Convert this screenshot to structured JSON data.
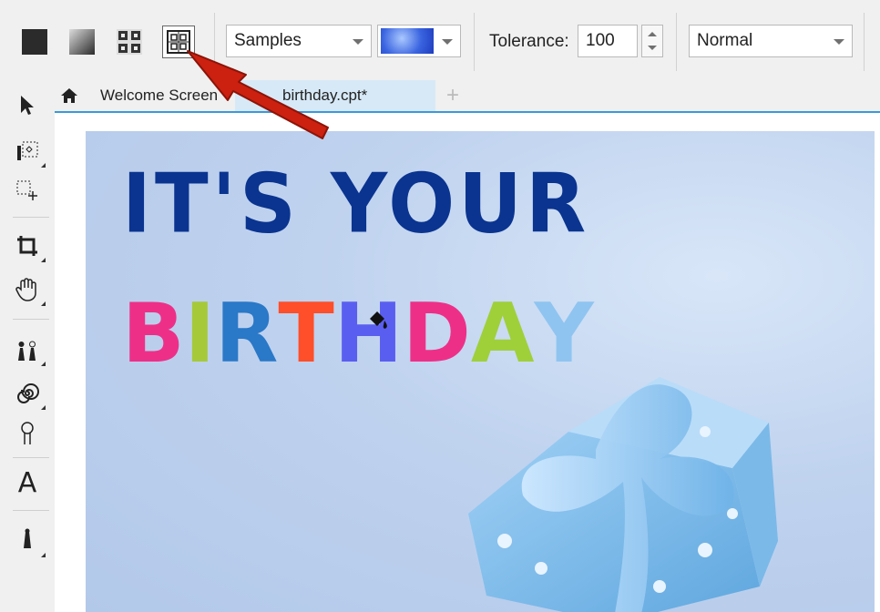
{
  "property_bar": {
    "tools": [
      "fill-flat-icon",
      "fill-gradient-icon",
      "fill-pattern-icon",
      "fill-texture-icon"
    ],
    "library_dropdown": "Samples",
    "texture_preview": "texture-swatch",
    "tolerance_label": "Tolerance:",
    "tolerance_value": "100",
    "blend_mode": "Normal"
  },
  "tabs": [
    {
      "label": "Welcome Screen",
      "active": false
    },
    {
      "label": "birthday.cpt*",
      "active": true
    }
  ],
  "toolbox": [
    "pick-icon",
    "mask-icon",
    "freehand-mask-icon",
    "crop-icon",
    "pan-icon",
    "clone-icon",
    "spiral-icon",
    "pin-icon",
    "text-icon",
    "fill-icon"
  ],
  "canvas": {
    "line1": "IT'S YOUR",
    "line2_letters": [
      "B",
      "I",
      "R",
      "T",
      "H",
      "D",
      "A",
      "Y"
    ],
    "letter_colors": [
      "#ee2f88",
      "#a6c93a",
      "#2a78c8",
      "#ff4e2a",
      "#5a5ef0",
      "#ee2f88",
      "#9fd03a",
      "#8fc4f0"
    ]
  },
  "annotation": {
    "arrow_color": "#cc2010"
  }
}
